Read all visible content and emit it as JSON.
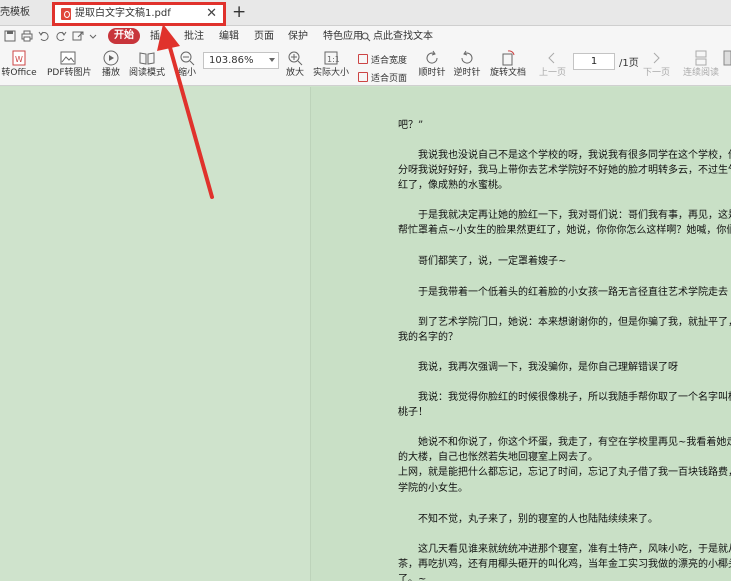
{
  "tabs": {
    "left_tab_label": "壳模板",
    "active_tab_title": "提取白文字文稿1.pdf",
    "close_symbol": "✕",
    "new_tab_symbol": "+"
  },
  "menu": {
    "start": "开始",
    "insert": "插入",
    "annotate": "批注",
    "edit": "编辑",
    "page": "页面",
    "protect": "保护",
    "special": "特色应用",
    "find_text": "点此查找文本"
  },
  "tools": {
    "to_office": "转Office",
    "pdf_to_image": "PDF转图片",
    "play": "播放",
    "read_mode": "阅读模式",
    "zoom_out": "缩小",
    "zoom_value": "103.86%",
    "zoom_in": "放大",
    "actual_size": "实际大小",
    "fit_width": "适合宽度",
    "fit_page": "适合页面",
    "rotate_cw": "顺时针",
    "rotate_ccw": "逆时针",
    "rotate_doc": "旋转文档",
    "prev_page": "上一页",
    "page_current": "1",
    "page_total": "/1页",
    "next_page": "下一页",
    "continuous_read": "连续阅读"
  },
  "document": {
    "lines": [
      "吧？”",
      "　　我说我也没说自己不是这个学校的呀，我说我有很多同学在这个学校，他",
      "分呀我说好好好，我马上带你去艺术学院好不好她的脸才明转多云，不过生气",
      "红了，像成熟的水蜜桃。",
      "　　于是我就决定再让她的脸红一下，我对哥们说：哥们我有事，再见，这是我女朋",
      "帮忙罩着点~小女生的脸果然更红了，她说，你你你怎么这样啊？她喊，你们不要",
      "　　哥们都笑了，说，一定罩着嫂子~",
      "　　于是我带着一个低着头的红着脸的小女孩一路无言径直往艺术学院走去",
      "　　到了艺术学院门口，她说：本来想谢谢你的，但是你骗了我，就扯平了，不过，",
      "我的名字的？",
      "　　我说，我再次强调一下，我没骗你，是你自己理解错误了呀",
      "　　我说：我觉得你脸红的时候很像桃子，所以我随手帮你取了一个名字叫桃子，没想",
      "桃子！",
      "　　她说不和你说了，你这个坏蛋，我走了，有空在学校里再见~我看着她走",
      "的大楼，自己也怅然若失地回寝室上网去了。",
      "上网，就是能把什么都忘记，忘记了时间，忘记了丸子借了我一百块钱路费，忘记了",
      "学院的小女生。",
      "　　不知不觉，丸子来了，别的寝室的人也陆陆续续来了。",
      "　　这几天看见谁来就统统冲进那个寝室，准有土特产，风味小吃，于是就从大",
      "茶，再吃扒鸡，还有用椰头砸开的叫化鸡，当年金工实习我做的漂亮的小椰头",
      "了。~"
    ]
  },
  "colors": {
    "accent_red": "#e0322c",
    "start_button": "#c8353b",
    "page_background": "#c9e0c6"
  }
}
